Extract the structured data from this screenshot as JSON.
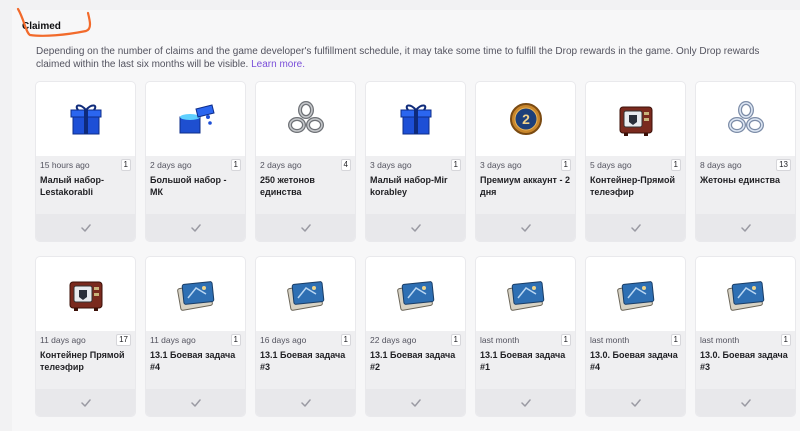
{
  "tab": {
    "label": "Claimed"
  },
  "description": {
    "text": "Depending on the number of claims and the game developer's fulfillment schedule, it may take some time to fulfill the Drop rewards in the game. Only Drop rewards claimed within the last six months will be visible.",
    "link": "Learn more."
  },
  "colors": {
    "accent": "#7a4ed9",
    "annotation": "#f26a2b"
  },
  "rows": [
    [
      {
        "time": "15 hours ago",
        "count": "1",
        "title": "Малый набор-Lestakorabli",
        "icon": "blue-gift-box-icon"
      },
      {
        "time": "2 days ago",
        "count": "1",
        "title": "Большой набор - МК",
        "icon": "open-blue-gift-box-icon"
      },
      {
        "time": "2 days ago",
        "count": "4",
        "title": "250 жетонов единства",
        "icon": "unity-token-silver-icon"
      },
      {
        "time": "3 days ago",
        "count": "1",
        "title": "Малый набор-Mir korabley",
        "icon": "blue-gift-box-icon"
      },
      {
        "time": "3 days ago",
        "count": "1",
        "title": "Премиум аккаунт - 2 дня",
        "icon": "premium-2-days-badge-icon"
      },
      {
        "time": "5 days ago",
        "count": "1",
        "title": "Контейнер-Прямой телеэфир",
        "icon": "tv-container-icon"
      },
      {
        "time": "8 days ago",
        "count": "13",
        "title": "Жетоны единства",
        "icon": "unity-token-blue-icon"
      }
    ],
    [
      {
        "time": "11 days ago",
        "count": "17",
        "title": "Контейнер Прямой телеэфир",
        "icon": "tv-container-icon"
      },
      {
        "time": "11 days ago",
        "count": "1",
        "title": "13.1 Боевая задача #4",
        "icon": "combat-mission-card-icon"
      },
      {
        "time": "16 days ago",
        "count": "1",
        "title": "13.1 Боевая задача #3",
        "icon": "combat-mission-card-icon"
      },
      {
        "time": "22 days ago",
        "count": "1",
        "title": "13.1 Боевая задача #2",
        "icon": "combat-mission-card-icon"
      },
      {
        "time": "last month",
        "count": "1",
        "title": "13.1 Боевая задача #1",
        "icon": "combat-mission-card-icon"
      },
      {
        "time": "last month",
        "count": "1",
        "title": "13.0. Боевая задача #4",
        "icon": "combat-mission-card-icon"
      },
      {
        "time": "last month",
        "count": "1",
        "title": "13.0. Боевая задача #3",
        "icon": "combat-mission-card-icon"
      }
    ]
  ],
  "footer_icon": "checkmark-icon"
}
